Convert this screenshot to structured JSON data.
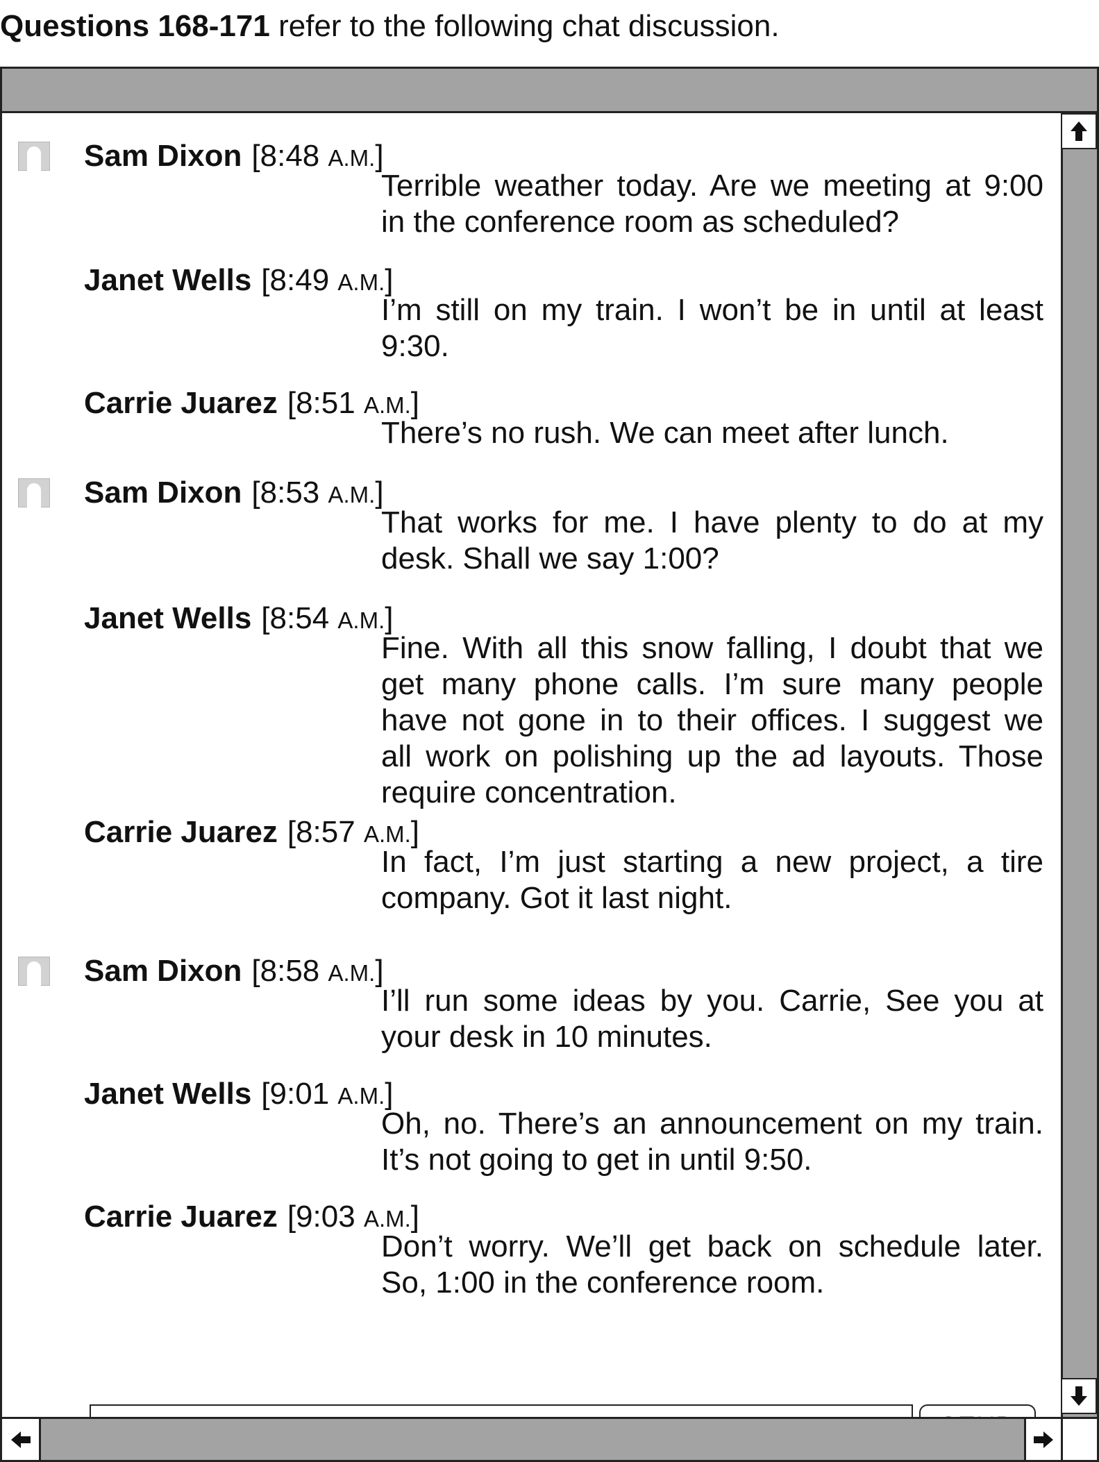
{
  "header": {
    "questions": "Questions 168-171",
    "rest": "refer to the following chat discussion."
  },
  "chat": {
    "messages": [
      {
        "name": "Sam Dixon",
        "time": "8:48",
        "ampm": "A.M.",
        "avatar": true,
        "lines": [
          "Terrible weather today.  Are we meeting at 9:00",
          "in the conference room as scheduled?"
        ]
      },
      {
        "name": "Janet Wells",
        "time": "8:49",
        "ampm": "A.M.",
        "avatar": false,
        "lines": [
          "I’m still on my train.  I won’t be in until at least",
          "9:30."
        ]
      },
      {
        "name": "Carrie Juarez",
        "time": "8:51",
        "ampm": "A.M.",
        "avatar": false,
        "lines": [
          "There’s no rush.  We can meet after lunch."
        ]
      },
      {
        "name": "Sam Dixon",
        "time": "8:53",
        "ampm": "A.M.",
        "avatar": true,
        "lines": [
          "That works for me.  I have plenty to do at my",
          "desk.  Shall we say 1:00?"
        ]
      },
      {
        "name": "Janet Wells",
        "time": "8:54",
        "ampm": "A.M.",
        "avatar": false,
        "lines": [
          "Fine.  With all this snow falling, I doubt that we",
          "get many phone calls.  I’m sure many people",
          "have not gone in to their offices.  I suggest we",
          "all work on polishing up the ad layouts.  Those",
          "require concentration."
        ]
      },
      {
        "name": "Carrie Juarez",
        "time": "8:57",
        "ampm": "A.M.",
        "avatar": false,
        "lines": [
          "In fact, I’m just starting a new project, a tire",
          "company.  Got it last night."
        ]
      },
      {
        "name": "Sam Dixon",
        "time": "8:58",
        "ampm": "A.M.",
        "avatar": true,
        "lines": [
          "I’ll run some ideas by you.  Carrie, See you at",
          "your desk in 10 minutes."
        ]
      },
      {
        "name": "Janet Wells",
        "time": "9:01",
        "ampm": "A.M.",
        "avatar": false,
        "lines": [
          "Oh, no.  There’s an announcement on my train.",
          "It’s not going to get in until 9:50."
        ]
      },
      {
        "name": "Carrie Juarez",
        "time": "9:03",
        "ampm": "A.M.",
        "avatar": false,
        "lines": [
          "Don’t worry.  We’ll get back on schedule later.",
          "So, 1:00 in the conference room."
        ]
      }
    ]
  },
  "composer": {
    "input_value": "",
    "send_label": "SEND"
  },
  "icons": {
    "scroll_up": "arrow-up-icon",
    "scroll_down": "arrow-down-icon",
    "scroll_left": "arrow-left-icon",
    "scroll_right": "arrow-right-icon",
    "avatar": "user-avatar-icon"
  },
  "colors": {
    "bar_gray": "#a3a3a3",
    "border": "#222222"
  }
}
